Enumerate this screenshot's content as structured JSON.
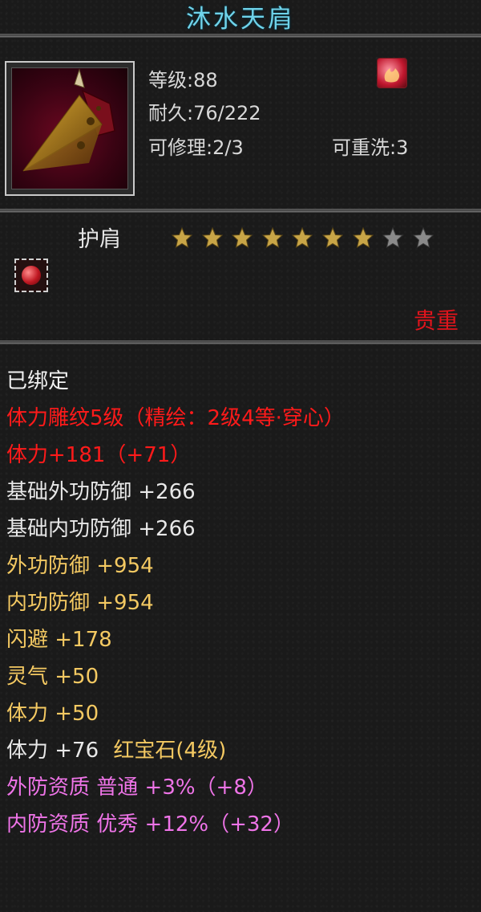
{
  "item": {
    "title": "沐水天肩",
    "level": "等级:88",
    "durability": "耐久:76/222",
    "repairable": "可修理:2/3",
    "rewashable": "可重洗:3",
    "name": "护肩",
    "rarity": "贵重",
    "star_rating": {
      "filled": 7,
      "total": 9
    }
  },
  "attributes": {
    "bound": "已绑定",
    "engraving": "体力雕纹5级（精绘：2级4等·穿心）",
    "stamina_bonus": "体力+181（+71）",
    "base_ext_def": "基础外功防御 +266",
    "base_int_def": "基础内功防御 +266",
    "ext_def": "外功防御 +954",
    "int_def": "内功防御 +954",
    "dodge": "闪避 +178",
    "spirit": "灵气 +50",
    "stamina": "体力 +50",
    "gem_prefix": "体力 +76",
    "gem_name": "红宝石(4级)",
    "ext_quality": "外防资质 普通 +3%（+8）",
    "int_quality": "内防资质 优秀 +12%（+32）"
  },
  "colors": {
    "title": "#6fd3ea",
    "rarity": "#e0141c",
    "red_attr": "#ff1a1a",
    "gold_attr": "#f4c962",
    "pink_attr": "#ef74e8"
  },
  "icons": {
    "item_icon": "gold-spiked-shoulder-pauldron-icon",
    "badge_icon": "red-flame-badge-icon",
    "gem_slot_icon": "red-gem-socket-icon",
    "star_icon": "star-icon"
  }
}
